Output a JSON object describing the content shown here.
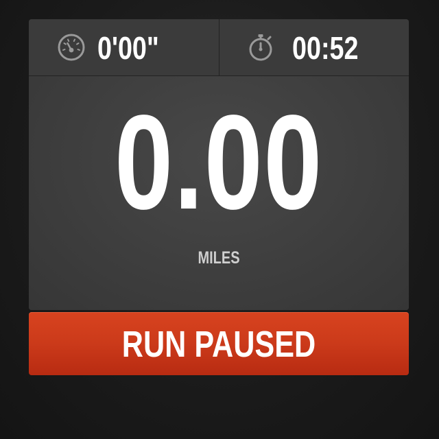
{
  "stats": {
    "pace": {
      "value": "0'00\"",
      "icon": "speedometer-icon"
    },
    "duration": {
      "value": "00:52",
      "icon": "stopwatch-icon"
    }
  },
  "distance": {
    "value": "0.00",
    "unit": "MILES"
  },
  "status_button": {
    "label": "RUN PAUSED",
    "color": "#cb3a1a"
  },
  "colors": {
    "background": "#1b1b1b",
    "panel": "#3e3e3e",
    "text": "#ffffff",
    "icon": "#9a9a9a"
  }
}
